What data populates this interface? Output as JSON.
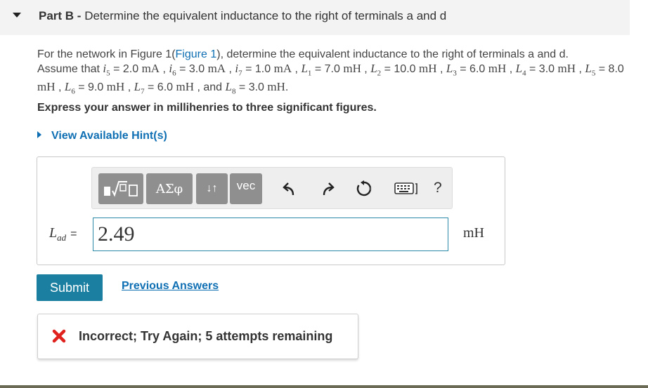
{
  "part": {
    "label": "Part B -",
    "title": "Determine the equivalent inductance to the right of terminals a and d"
  },
  "problem": {
    "t1": "For the network in Figure 1(",
    "figure_link": "Figure 1",
    "t2": "), determine the equivalent inductance to the right of terminals a and d.",
    "t3": "Assume that",
    "i5_val": "= 2.0",
    "i6_val": "= 3.0",
    "i7_val": "= 1.0",
    "L1_val": "= 7.0",
    "L2_val": "= 10.0",
    "L3_val": "= 6.0",
    "L4_val": "= 3.0",
    "L5_val": "= 8.0",
    "L6_val": "= 9.0",
    "L7_val": "= 6.0",
    "L8_val": "= 3.0",
    "and": "and",
    "unit_mA": "mA",
    "unit_mH": "mH"
  },
  "instruction": "Express your answer in millihenries to three significant figures.",
  "hint_link": "View Available Hint(s)",
  "toolbar": {
    "greek": "ΑΣφ",
    "sort": "↓↑",
    "vec": "vec",
    "help": "?",
    "icons": [
      "fraction-sqrt-template-icon",
      "undo-icon",
      "redo-icon",
      "reset-icon",
      "keyboard-icon"
    ]
  },
  "answer": {
    "lhs_var": "L",
    "lhs_sub": "ad",
    "lhs_eq": "=",
    "value": "2.49",
    "unit": "mH"
  },
  "submit_label": "Submit",
  "previous_answers_label": "Previous Answers",
  "feedback": {
    "message": "Incorrect; Try Again; 5 attempts remaining",
    "icon": "x-icon",
    "icon_color": "#e0221e"
  },
  "colors": {
    "link": "#0f6fb3",
    "submit": "#1a7fa0",
    "toolbar_button": "#8f8f8f",
    "input_border": "#2c8aa8"
  }
}
